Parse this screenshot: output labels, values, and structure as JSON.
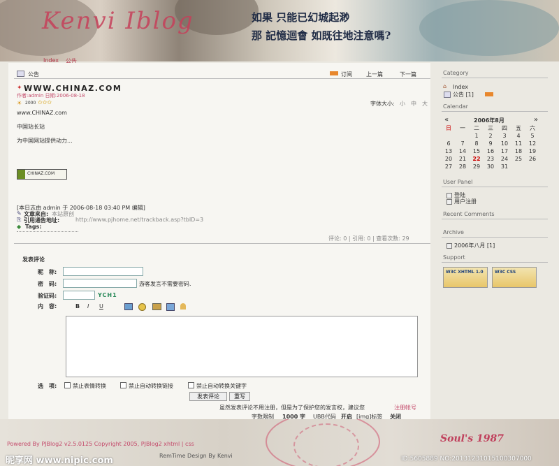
{
  "header": {
    "brand": "Kenvi Iblog",
    "tagline_1": "如果 只能已幻城起渺",
    "tagline_2": "那 記憶迴會 如既往地注意嗎?"
  },
  "nav": {
    "items": [
      {
        "label": "Index"
      },
      {
        "label": "公告"
      }
    ]
  },
  "post": {
    "breadcrumb": "公告",
    "toolbar": {
      "subscribe": "订阅",
      "prev": "上一篇",
      "next": "下一篇"
    },
    "title": "WWW.CHINAZ.COM",
    "meta": "作者:admin 日期:2006-08-18",
    "rating_label": "2000",
    "font_size_label": "字体大小:",
    "font_sizes": [
      "小",
      "中",
      "大"
    ],
    "body": [
      "www.CHINAZ.com",
      "中国站长站",
      "为中国网站提供动力..."
    ],
    "logo_text": "CHINAZ.COM",
    "edit_note": "[本日志由 admin 于 2006-08-18 03:40 PM 编辑]",
    "source_label": "文章来自:",
    "source_value": "本站原创",
    "trackback_label": "引用通告地址:",
    "trackback_url": "http://www.pjhome.net/trackback.asp?tbID=3",
    "tags_label": "Tags:",
    "stats": "评论: 0 | 引用: 0 | 查看次数: 29"
  },
  "comment_form": {
    "heading": "发表评论",
    "nickname_label": "昵　称:",
    "password_label": "密　码:",
    "password_hint": "游客发言不需要密码.",
    "captcha_label": "验证码:",
    "captcha_value": "YCH1",
    "content_label": "内　容:",
    "toolbar": [
      "B",
      "I",
      "U"
    ],
    "options_label": "选　项:",
    "options": [
      "禁止表情转换",
      "禁止自动转换链接",
      "禁止自动转换关键字"
    ],
    "submit": "发表评论",
    "reset": "重写",
    "notice_prefix": "虽然发表评论不用注册，但是为了保护您的发言权，建议您",
    "notice_link": "注册帐号",
    "limits_prefix": "字数限制",
    "limits_value": "1000 字",
    "ubb": "UBB代码",
    "ubb_state": "开启",
    "img_tag": "[img]标签",
    "img_state": "关闭"
  },
  "sidebar": {
    "category_title": "Category",
    "categories": [
      {
        "label": "Index"
      },
      {
        "label": "公告 [1]"
      }
    ],
    "calendar_title": "Calendar",
    "calendar": {
      "header": "2006年8月",
      "prev": "«",
      "next": "»",
      "weekdays": [
        "日",
        "一",
        "二",
        "三",
        "四",
        "五",
        "六"
      ],
      "weeks": [
        [
          "",
          "",
          "1",
          "2",
          "3",
          "4",
          "5"
        ],
        [
          "6",
          "7",
          "8",
          "9",
          "10",
          "11",
          "12"
        ],
        [
          "13",
          "14",
          "15",
          "16",
          "17",
          "18",
          "19"
        ],
        [
          "20",
          "21",
          "22",
          "23",
          "24",
          "25",
          "26"
        ],
        [
          "27",
          "28",
          "29",
          "30",
          "31",
          "",
          ""
        ]
      ],
      "today": "22"
    },
    "user_panel_title": "User Panel",
    "user_links": [
      {
        "label": "登陆"
      },
      {
        "label": "用户注册"
      }
    ],
    "recent_comments_title": "Recent Comments",
    "archive_title": "Archive",
    "archive_items": [
      {
        "label": "2006年八月 [1]"
      }
    ],
    "support_title": "Support",
    "badges": [
      "W3C XHTML 1.0",
      "W3C CSS"
    ]
  },
  "footer": {
    "powered": "Powered By PJBlog2 v2.5.0125 Copyright 2005, PJBlog2 xhtml | css",
    "design": "RemTime Design By Kenvi",
    "signature": "Soul's 1987",
    "watermark_left": "昵享网 www.nipic.com",
    "watermark_right": "ID:5605889 NO:20131231015100307000"
  }
}
